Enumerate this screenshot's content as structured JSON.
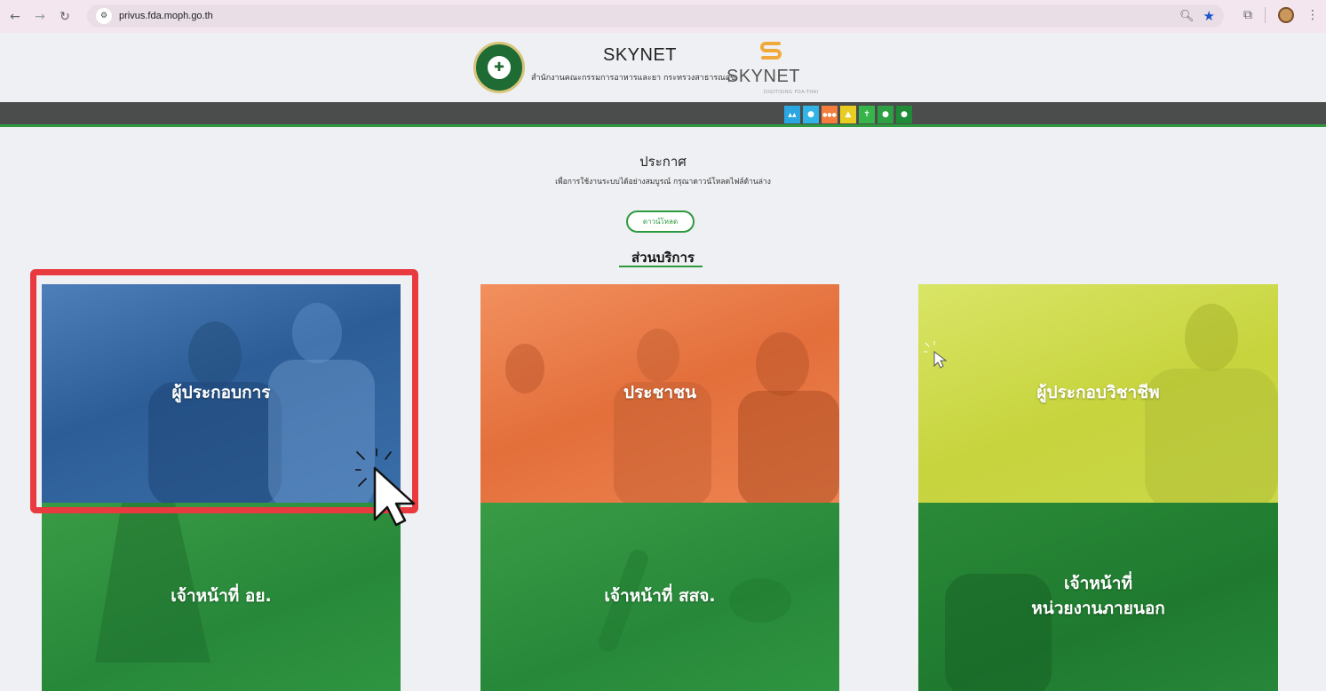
{
  "browser": {
    "url": "privus.fda.moph.go.th",
    "back_icon": "arrow-left-icon",
    "forward_icon": "arrow-right-icon",
    "reload_icon": "reload-icon"
  },
  "header": {
    "brand_title": "SKYNET",
    "brand_subtitle": "สำนักงานคณะกรรมการอาหารและยา กระทรวงสาธารณสุข",
    "skynet_logo_word": "SKYNET",
    "skynet_logo_tag": "DIGITISING FDA-THAI",
    "accent": "#2e9a3e"
  },
  "role_icons": [
    {
      "name": "operator",
      "glyph": "▲▲",
      "color": "#2aa7e0"
    },
    {
      "name": "public",
      "glyph": "●",
      "color": "#32b5e6"
    },
    {
      "name": "group",
      "glyph": "●●●",
      "color": "#f47c3c"
    },
    {
      "name": "professional",
      "glyph": "▲",
      "color": "#e9cc22"
    },
    {
      "name": "fda-staff",
      "glyph": "✝",
      "color": "#38b54a"
    },
    {
      "name": "provincial-staff",
      "glyph": "●",
      "color": "#2ea043"
    },
    {
      "name": "external-staff",
      "glyph": "●",
      "color": "#1f8a37"
    }
  ],
  "announcement": {
    "title": "ประกาศ",
    "text": "เพื่อการใช้งานระบบได้อย่างสมบูรณ์ กรุณาดาวน์โหลดไฟล์ด้านล่าง",
    "download_label": "ดาวน์โหลด"
  },
  "services": {
    "title": "ส่วนบริการ",
    "tiles": [
      {
        "label": "ผู้ประกอบการ",
        "color": "#2d5d97"
      },
      {
        "label": "ประชาชน",
        "color": "#e36f3b"
      },
      {
        "label": "ผู้ประกอบวิชาชีพ",
        "color": "#c7d43d"
      },
      {
        "label": "เจ้าหน้าที่ อย.",
        "color": "#27883a"
      },
      {
        "label": "เจ้าหน้าที่ สสจ.",
        "color": "#27883a"
      },
      {
        "label_line1": "เจ้าหน้าที่",
        "label_line2": "หน่วยงานภายนอก",
        "color": "#1f7a2f"
      }
    ]
  }
}
